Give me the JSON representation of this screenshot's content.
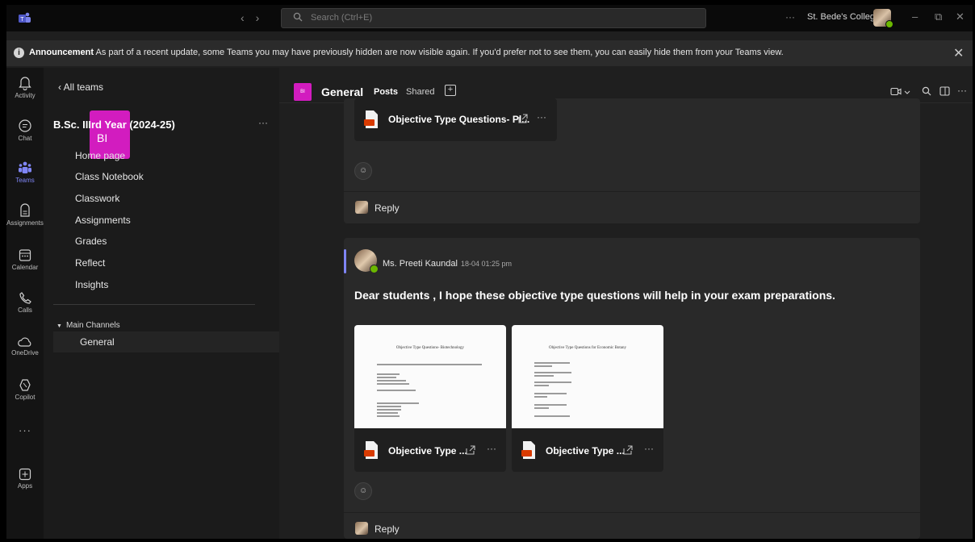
{
  "titlebar": {
    "search_placeholder": "Search (Ctrl+E)",
    "more": "···",
    "org": "St. Bede's College",
    "minimize": "–",
    "restore": "⧉",
    "close": "✕"
  },
  "announcement": {
    "label": "Announcement",
    "text": " As part of a recent update, some Teams you may have previously hidden are now visible again. If you'd prefer not to see them, you can easily hide them from your Teams view.",
    "close": "✕"
  },
  "rail": {
    "activity": "Activity",
    "chat": "Chat",
    "teams": "Teams",
    "assignments": "Assignments",
    "calendar": "Calendar",
    "calls": "Calls",
    "onedrive": "OneDrive",
    "copilot": "Copilot",
    "more": "···",
    "apps": "Apps"
  },
  "panel": {
    "back": "‹  All teams",
    "team_initials": "BI",
    "team_name": "B.Sc. IIIrd Year (2024-25)",
    "team_more": "···",
    "links": [
      "Home page",
      "Class Notebook",
      "Classwork",
      "Assignments",
      "Grades",
      "Reflect",
      "Insights"
    ],
    "channels_header": "Main Channels",
    "channel": "General"
  },
  "channel_header": {
    "initials": "BI",
    "name": "General",
    "tab_posts": "Posts",
    "tab_shared": "Shared",
    "add_tab": "+",
    "more": "···"
  },
  "feed": {
    "post1": {
      "file_name": "Objective Type Questions- Pl...",
      "reply": "Reply"
    },
    "post2": {
      "author": "Ms. Preeti Kaundal",
      "time": "18-04 01:25 pm",
      "message": "Dear students , I hope these objective type questions will help in your exam preparations.",
      "files": [
        {
          "name": "Objective Type ...",
          "thumb_title": "Objective Type Questions- Biotechnology"
        },
        {
          "name": "Objective Type ...",
          "thumb_title": "Objective Type Questions for Economic Botany"
        }
      ],
      "reply": "Reply"
    }
  },
  "colors": {
    "brand": "#d21cbf",
    "accent": "#7f85f5",
    "presence": "#6bb700"
  }
}
